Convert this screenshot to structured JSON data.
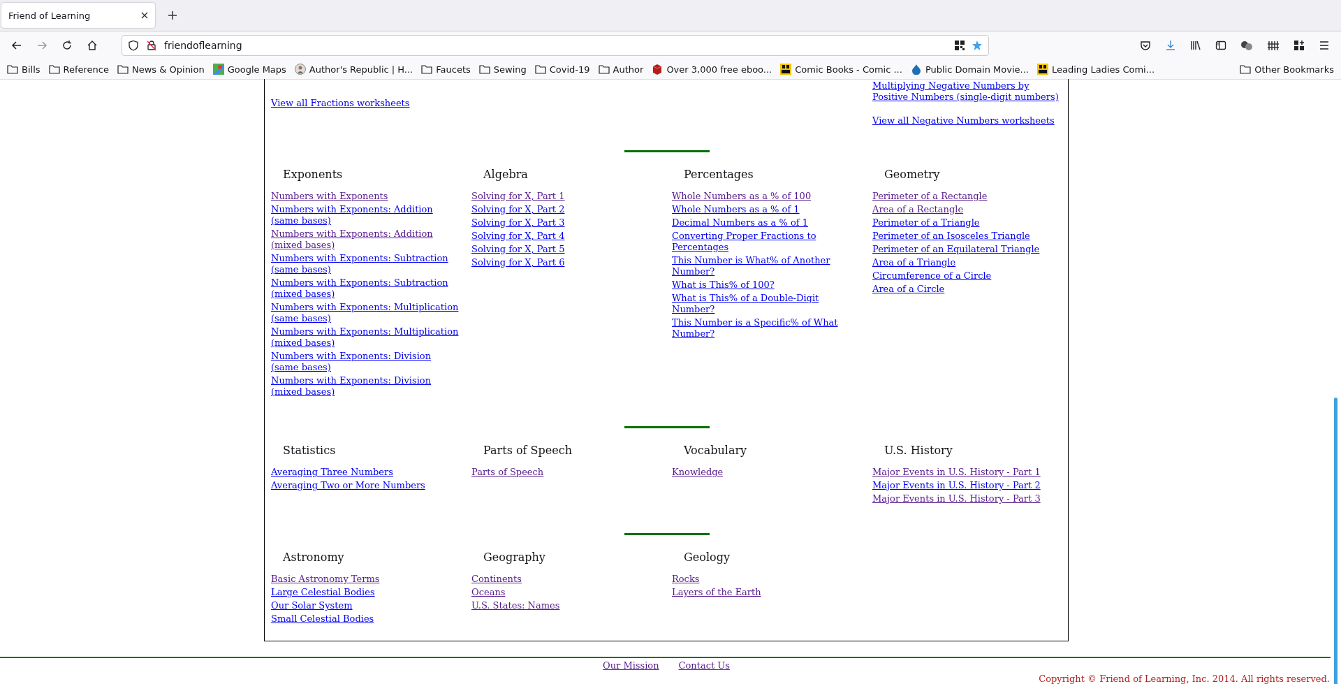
{
  "browser": {
    "tabs": [
      {
        "title": "Friend of Learning",
        "selected": true
      }
    ],
    "url": "friendoflearning",
    "bookmarks": [
      {
        "label": "Bills",
        "kind": "folder"
      },
      {
        "label": "Reference",
        "kind": "folder"
      },
      {
        "label": "News & Opinion",
        "kind": "folder"
      },
      {
        "label": "Google Maps",
        "kind": "map"
      },
      {
        "label": "Author's Republic | H...",
        "kind": "person"
      },
      {
        "label": "Faucets",
        "kind": "folder"
      },
      {
        "label": "Sewing",
        "kind": "folder"
      },
      {
        "label": "Covid-19",
        "kind": "folder"
      },
      {
        "label": "Author",
        "kind": "folder"
      },
      {
        "label": "Over 3,000 free eboo...",
        "kind": "book"
      },
      {
        "label": "Comic Books - Comic ...",
        "kind": "comic"
      },
      {
        "label": "Public Domain Movie...",
        "kind": "drop"
      },
      {
        "label": "Leading Ladies Comi...",
        "kind": "comic"
      }
    ],
    "other_bookmarks": "Other Bookmarks"
  },
  "page": {
    "top_columns": [
      {
        "links": [
          {
            "text": "View all Fractions worksheets",
            "visited": false
          }
        ]
      },
      {},
      {},
      {
        "links": [
          {
            "text": "Multiplying Negative Numbers by Positive Numbers (single-digit numbers)",
            "visited": false
          },
          {
            "text": "View all Negative Numbers worksheets",
            "visited": false
          }
        ]
      }
    ],
    "sections": [
      {
        "columns": [
          {
            "heading": "Exponents",
            "links": [
              {
                "text": "Numbers with Exponents",
                "visited": true
              },
              {
                "text": "Numbers with Exponents: Addition (same bases)",
                "visited": false
              },
              {
                "text": "Numbers with Exponents: Addition (mixed bases)",
                "visited": true
              },
              {
                "text": "Numbers with Exponents: Subtraction (same bases)",
                "visited": false
              },
              {
                "text": "Numbers with Exponents: Subtraction (mixed bases)",
                "visited": false
              },
              {
                "text": "Numbers with Exponents: Multiplication (same bases)",
                "visited": false
              },
              {
                "text": "Numbers with Exponents: Multiplication (mixed bases)",
                "visited": false
              },
              {
                "text": "Numbers with Exponents: Division (same bases)",
                "visited": false
              },
              {
                "text": "Numbers with Exponents: Division (mixed bases)",
                "visited": false
              }
            ]
          },
          {
            "heading": "Algebra",
            "links": [
              {
                "text": "Solving for X, Part 1",
                "visited": true
              },
              {
                "text": "Solving for X, Part 2",
                "visited": false
              },
              {
                "text": "Solving for X, Part 3",
                "visited": false
              },
              {
                "text": "Solving for X, Part 4",
                "visited": false
              },
              {
                "text": "Solving for X, Part 5",
                "visited": false
              },
              {
                "text": "Solving for X, Part 6",
                "visited": false
              }
            ]
          },
          {
            "heading": "Percentages",
            "links": [
              {
                "text": "Whole Numbers as a % of 100",
                "visited": true
              },
              {
                "text": "Whole Numbers as a % of 1",
                "visited": false
              },
              {
                "text": "Decimal Numbers as a % of 1",
                "visited": false
              },
              {
                "text": "Converting Proper Fractions to Percentages",
                "visited": false
              },
              {
                "text": "This Number is What% of Another Number?",
                "visited": false
              },
              {
                "text": "What is This% of 100?",
                "visited": false
              },
              {
                "text": "What is This% of a Double-Digit Number?",
                "visited": false
              },
              {
                "text": "This Number is a Specific% of What Number?",
                "visited": false
              }
            ]
          },
          {
            "heading": "Geometry",
            "links": [
              {
                "text": "Perimeter of a Rectangle",
                "visited": true
              },
              {
                "text": "Area of a Rectangle",
                "visited": true
              },
              {
                "text": "Perimeter of a Triangle",
                "visited": false
              },
              {
                "text": "Perimeter of an Isosceles Triangle",
                "visited": false
              },
              {
                "text": "Perimeter of an Equilateral Triangle",
                "visited": false
              },
              {
                "text": "Area of a Triangle",
                "visited": false
              },
              {
                "text": "Circumference of a Circle",
                "visited": false
              },
              {
                "text": "Area of a Circle",
                "visited": false
              }
            ]
          }
        ]
      },
      {
        "columns": [
          {
            "heading": "Statistics",
            "links": [
              {
                "text": "Averaging Three Numbers",
                "visited": false
              },
              {
                "text": "Averaging Two or More Numbers",
                "visited": false
              }
            ]
          },
          {
            "heading": "Parts of Speech",
            "links": [
              {
                "text": "Parts of Speech",
                "visited": true
              }
            ]
          },
          {
            "heading": "Vocabulary",
            "links": [
              {
                "text": "Knowledge",
                "visited": true
              }
            ]
          },
          {
            "heading": "U.S. History",
            "links": [
              {
                "text": "Major Events in U.S. History - Part 1",
                "visited": true
              },
              {
                "text": "Major Events in U.S. History - Part 2",
                "visited": false
              },
              {
                "text": "Major Events in U.S. History - Part 3",
                "visited": true
              }
            ]
          }
        ]
      },
      {
        "columns": [
          {
            "heading": "Astronomy",
            "links": [
              {
                "text": "Basic Astronomy Terms",
                "visited": true
              },
              {
                "text": "Large Celestial Bodies",
                "visited": false
              },
              {
                "text": "Our Solar System",
                "visited": false
              },
              {
                "text": "Small Celestial Bodies",
                "visited": false
              }
            ]
          },
          {
            "heading": "Geography",
            "links": [
              {
                "text": "Continents",
                "visited": true
              },
              {
                "text": "Oceans",
                "visited": true
              },
              {
                "text": "U.S. States: Names",
                "visited": true
              }
            ]
          },
          {
            "heading": "Geology",
            "links": [
              {
                "text": "Rocks",
                "visited": true
              },
              {
                "text": "Layers of the Earth",
                "visited": true
              }
            ]
          }
        ]
      }
    ]
  },
  "footer": {
    "links": [
      {
        "text": "Our Mission",
        "visited": true
      },
      {
        "text": "Contact Us",
        "visited": true
      }
    ],
    "copyright": "Copyright © Friend of Learning, Inc. 2014. All rights reserved."
  }
}
